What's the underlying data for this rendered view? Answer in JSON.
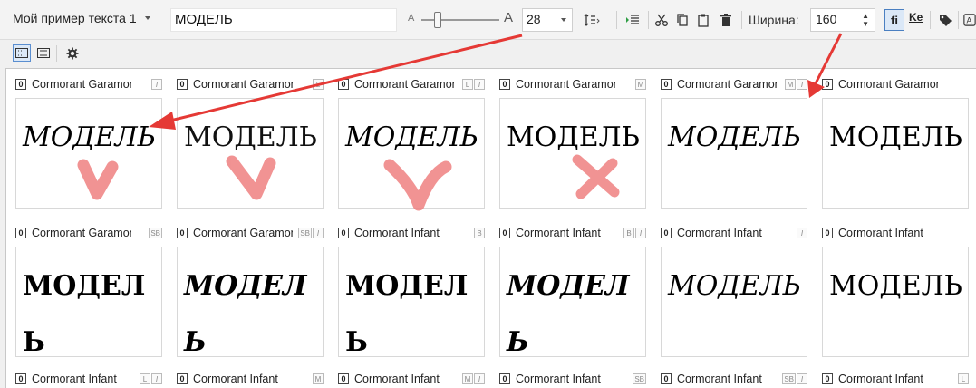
{
  "toolbar": {
    "sample_name": "Мой пример текста 1",
    "sample_text": "МОДЕЛЬ",
    "size_small_glyph": "A",
    "size_large_glyph": "A",
    "font_size": "28",
    "width_label": "Ширина:",
    "width_value": "160",
    "ligature_label": "fi",
    "kerning_label": "Ke",
    "icons": [
      "line-spacing-icon",
      "text-direction-icon",
      "cut-icon",
      "copy-icon",
      "paste-icon",
      "delete-icon",
      "tag-icon",
      "text-case-icon"
    ]
  },
  "view": {
    "icons": [
      "grid-view-icon",
      "list-view-icon",
      "settings-gear-icon"
    ]
  },
  "badge_zero": "0",
  "rows": [
    [
      {
        "font": "Cormorant Garamond",
        "badges": [
          "I"
        ],
        "style": "italic",
        "preview": "МОДЕЛЬ"
      },
      {
        "font": "Cormorant Garamond",
        "badges": [
          "L"
        ],
        "style": "light",
        "preview": "МОДЕЛЬ"
      },
      {
        "font": "Cormorant Garamond",
        "badges": [
          "L",
          "I"
        ],
        "style": "italic",
        "preview": "МОДЕЛЬ"
      },
      {
        "font": "Cormorant Garamond",
        "badges": [
          "M"
        ],
        "style": "regular",
        "preview": "МОДЕЛЬ"
      },
      {
        "font": "Cormorant Garamond",
        "badges": [
          "M",
          "I"
        ],
        "style": "italic",
        "preview": "МОДЕЛЬ"
      },
      {
        "font": "Cormorant Garamond",
        "badges": [],
        "style": "regular",
        "preview": "МОДЕЛЬ"
      }
    ],
    [
      {
        "font": "Cormorant Garamond",
        "badges": [
          "SB"
        ],
        "style": "bold",
        "preview": "МОДЕЛЬ"
      },
      {
        "font": "Cormorant Garamond",
        "badges": [
          "SB",
          "I"
        ],
        "style": "bold italic",
        "preview": "МОДЕЛЬ"
      },
      {
        "font": "Cormorant Infant",
        "badges": [
          "B"
        ],
        "style": "bold",
        "preview": "МОДЕЛЬ"
      },
      {
        "font": "Cormorant Infant",
        "badges": [
          "B",
          "I"
        ],
        "style": "bold italic",
        "preview": "МОДЕЛЬ"
      },
      {
        "font": "Cormorant Infant",
        "badges": [
          "I"
        ],
        "style": "italic",
        "preview": "МОДЕЛЬ"
      },
      {
        "font": "Cormorant Infant",
        "badges": [],
        "style": "regular",
        "preview": "МОДЕЛЬ"
      }
    ],
    [
      {
        "font": "Cormorant Infant",
        "badges": [
          "L",
          "I"
        ]
      },
      {
        "font": "Cormorant Infant",
        "badges": [
          "M"
        ]
      },
      {
        "font": "Cormorant Infant",
        "badges": [
          "M",
          "I"
        ]
      },
      {
        "font": "Cormorant Infant",
        "badges": [
          "SB"
        ]
      },
      {
        "font": "Cormorant Infant",
        "badges": [
          "SB",
          "I"
        ]
      },
      {
        "font": "Cormorant Infant",
        "badges": [
          "L"
        ]
      }
    ]
  ],
  "annotations": [
    "checkmark",
    "checkmark",
    "checkmark",
    "cross"
  ],
  "annotation_color": "#ee8080",
  "arrow_color": "#e53935"
}
